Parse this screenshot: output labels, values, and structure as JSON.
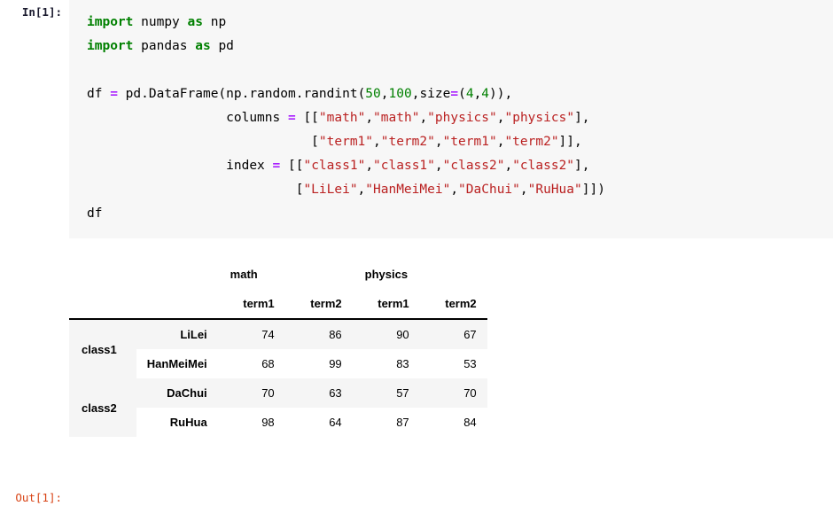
{
  "cell": {
    "input_prompt": "In[1]:",
    "output_prompt": "Out[1]:",
    "code_lines": [
      "import numpy as np",
      "import pandas as pd",
      "",
      "df = pd.DataFrame(np.random.randint(50,100,size=(4,4)),",
      "                  columns = [[\"math\",\"math\",\"physics\",\"physics\"],",
      "                             [\"term1\",\"term2\",\"term1\",\"term2\"]],",
      "                  index = [[\"class1\",\"class1\",\"class2\",\"class2\"],",
      "                           [\"LiLei\",\"HanMeiMei\",\"DaChui\",\"RuHua\"]])",
      "df"
    ],
    "tokens": {
      "kw_import": "import",
      "kw_as": "as",
      "mod_numpy": "numpy",
      "alias_np": "np",
      "mod_pandas": "pandas",
      "alias_pd": "pd",
      "var_df": "df",
      "op_assign": "=",
      "call_dataframe": "pd.DataFrame(np.random.randint(",
      "n_50": "50",
      "n_100": "100",
      "kwarg_size": "size",
      "n_4a": "4",
      "n_4b": "4",
      "kwarg_columns": "columns",
      "kwarg_index": "index",
      "s_math": "\"math\"",
      "s_physics": "\"physics\"",
      "s_term1": "\"term1\"",
      "s_term2": "\"term2\"",
      "s_class1": "\"class1\"",
      "s_class2": "\"class2\"",
      "s_lilei": "\"LiLei\"",
      "s_hanmeimei": "\"HanMeiMei\"",
      "s_dachui": "\"DaChui\"",
      "s_ruhua": "\"RuHua\""
    }
  },
  "table": {
    "column_groups": [
      {
        "label": "math",
        "span": 2
      },
      {
        "label": "physics",
        "span": 2
      }
    ],
    "sub_columns": [
      "term1",
      "term2",
      "term1",
      "term2"
    ],
    "index_names": [
      "",
      ""
    ],
    "rows": [
      {
        "class": "class1",
        "show_class": true,
        "name": "LiLei",
        "values": [
          74,
          86,
          90,
          67
        ],
        "shade": true
      },
      {
        "class": "class1",
        "show_class": false,
        "name": "HanMeiMei",
        "values": [
          68,
          99,
          83,
          53
        ],
        "shade": false
      },
      {
        "class": "class2",
        "show_class": true,
        "name": "DaChui",
        "values": [
          70,
          63,
          57,
          70
        ],
        "shade": true
      },
      {
        "class": "class2",
        "show_class": false,
        "name": "RuHua",
        "values": [
          98,
          64,
          87,
          84
        ],
        "shade": false
      }
    ]
  },
  "colors": {
    "keyword": "#008000",
    "string": "#ba2121",
    "number": "#008000",
    "operator": "#aa22ff",
    "out_prompt": "#d84315",
    "cell_bg": "#f7f7f7",
    "row_shade": "#f5f5f5"
  }
}
